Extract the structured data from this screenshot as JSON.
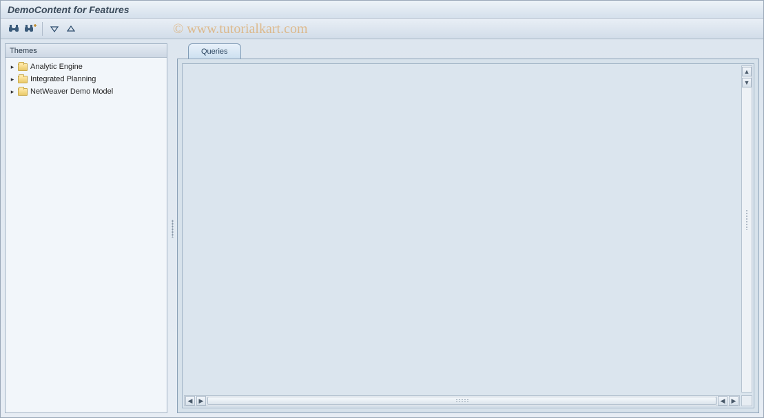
{
  "title": "DemoContent for Features",
  "watermark": "© www.tutorialkart.com",
  "toolbar": {
    "find_icon": "find-icon",
    "find_next_icon": "find-next-icon",
    "expand_icon": "expand-icon",
    "collapse_icon": "collapse-icon"
  },
  "sidebar": {
    "header": "Themes",
    "items": [
      {
        "label": "Analytic Engine"
      },
      {
        "label": "Integrated Planning"
      },
      {
        "label": "NetWeaver Demo Model"
      }
    ]
  },
  "main": {
    "tabs": [
      {
        "label": "Queries",
        "active": true
      }
    ]
  }
}
